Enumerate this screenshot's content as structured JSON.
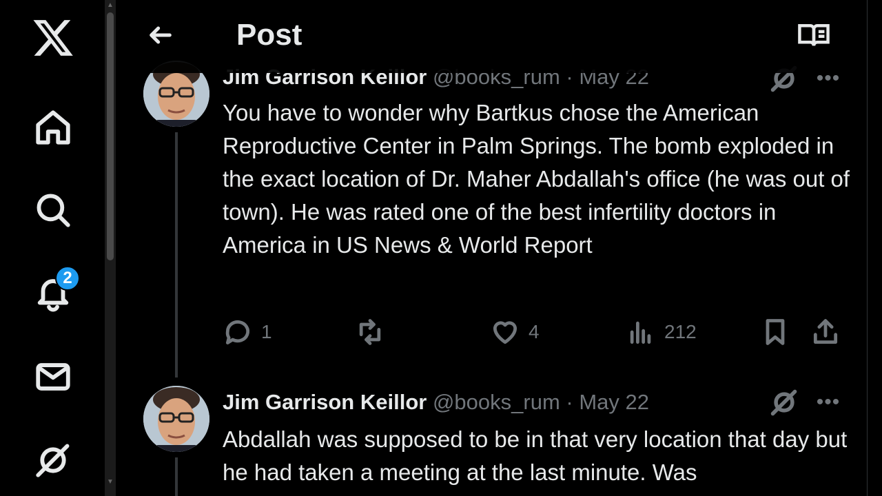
{
  "sidebar": {
    "logo": "x-logo-icon",
    "items": [
      {
        "name": "home-icon"
      },
      {
        "name": "search-icon"
      },
      {
        "name": "bell-icon",
        "badge": "2"
      },
      {
        "name": "mail-icon"
      },
      {
        "name": "grok-icon"
      }
    ]
  },
  "header": {
    "title": "Post",
    "back_icon": "arrow-left-icon",
    "reader_icon": "book-open-icon"
  },
  "posts": [
    {
      "author": "Jim Garrison Keillor",
      "handle": "@books_rum",
      "sep": "·",
      "date": "May 22",
      "text": "You have to wonder why Bartkus chose the American Reproductive Center in Palm Springs. The bomb exploded in the exact location of Dr. Maher Abdallah's office (he was out of town). He was rated one of the best infertility doctors in America in US News & World Report",
      "replies": "1",
      "reposts": "",
      "likes": "4",
      "views": "212"
    },
    {
      "author": "Jim Garrison Keillor",
      "handle": "@books_rum",
      "sep": "·",
      "date": "May 22",
      "text": "Abdallah was supposed to be in that very location that day but he had taken a meeting at the last minute. Was"
    }
  ],
  "colors": {
    "background": "#000000",
    "text": "#e7e9ea",
    "muted": "#71767b",
    "accent": "#1d9bf0"
  }
}
